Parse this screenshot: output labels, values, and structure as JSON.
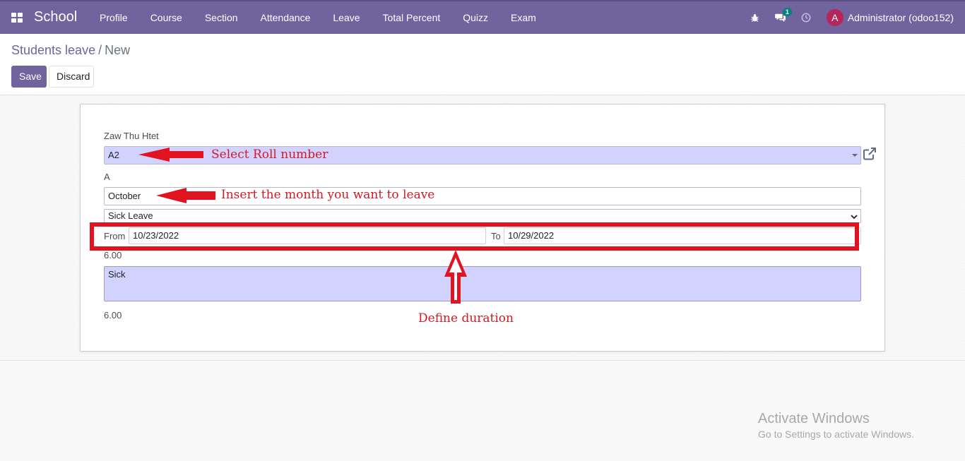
{
  "navbar": {
    "brand": "School",
    "menu": [
      "Profile",
      "Course",
      "Section",
      "Attendance",
      "Leave",
      "Total Percent",
      "Quizz",
      "Exam"
    ],
    "message_count": "1",
    "user_initial": "A",
    "user_name": "Administrator (odoo152)"
  },
  "breadcrumb": {
    "parent": "Students leave",
    "separator": "/",
    "current": "New"
  },
  "actions": {
    "save_label": "Save",
    "discard_label": "Discard"
  },
  "form": {
    "student_name": "Zaw Thu Htet",
    "roll_number": "A2",
    "section": "A",
    "month": "October",
    "leave_type": "Sick Leave",
    "from_label": "From",
    "from_date": "10/23/2022",
    "to_label": "To",
    "to_date": "10/29/2022",
    "duration": "6.00",
    "reason": "Sick",
    "total_days": "6.00"
  },
  "annotations": {
    "roll": "Select Roll number",
    "month": "Insert the month you want to leave",
    "duration": "Define duration",
    "color": "#e0131f"
  },
  "watermark": {
    "title": "Activate Windows",
    "subtitle": "Go to Settings to activate Windows."
  },
  "colors": {
    "navbar": "#71639e",
    "required_field": "#d2d2ff",
    "avatar": "#b6265b",
    "badge": "#018578"
  }
}
